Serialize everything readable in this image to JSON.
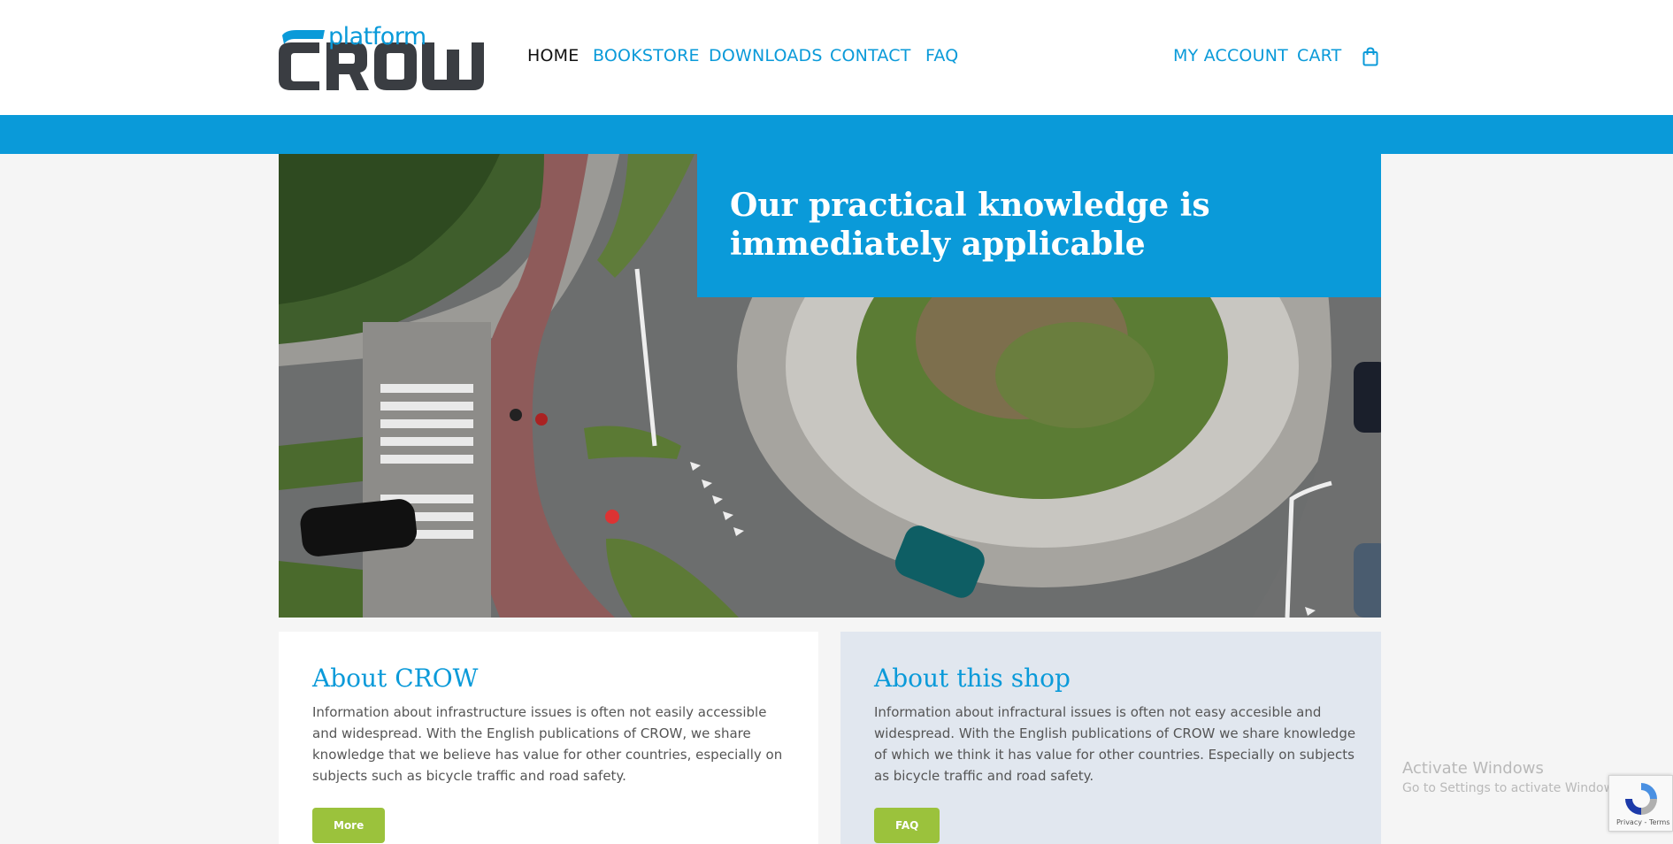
{
  "brand": {
    "logo_top": "platform",
    "logo_main": "CROW"
  },
  "nav": {
    "items": [
      "HOME",
      "BOOKSTORE",
      "DOWNLOADS",
      "CONTACT",
      "FAQ"
    ],
    "right_items": [
      "MY ACCOUNT",
      "CART"
    ],
    "cart_icon": "shopping-bag-icon"
  },
  "hero": {
    "title": "Our practical knowledge is immediately applicable",
    "image": "aerial-roundabout-photo"
  },
  "about_crow": {
    "title": "About CROW",
    "text": "Information about infrastructure issues is often not easily accessible and widespread. With the English publications of CROW, we share knowledge that we believe has value for other countries, especially on subjects such as bicycle traffic and road safety.",
    "button": "More"
  },
  "about_shop": {
    "title": "About this shop",
    "text": "Information about infractural issues is often not easy accesible and widespread. With the English publications of CROW we share knowledge of which we think it has value for other countries. Especially on subjects as bicycle traffic and road safety.",
    "button": "FAQ"
  },
  "os_watermark": {
    "line1": "Activate Windows",
    "line2": "Go to Settings to activate Windows."
  },
  "recaptcha": {
    "terms": "Privacy - Terms"
  },
  "colors": {
    "primary": "#0a9ad9",
    "button": "#9bc23c",
    "logo_dark": "#3a3d42"
  }
}
